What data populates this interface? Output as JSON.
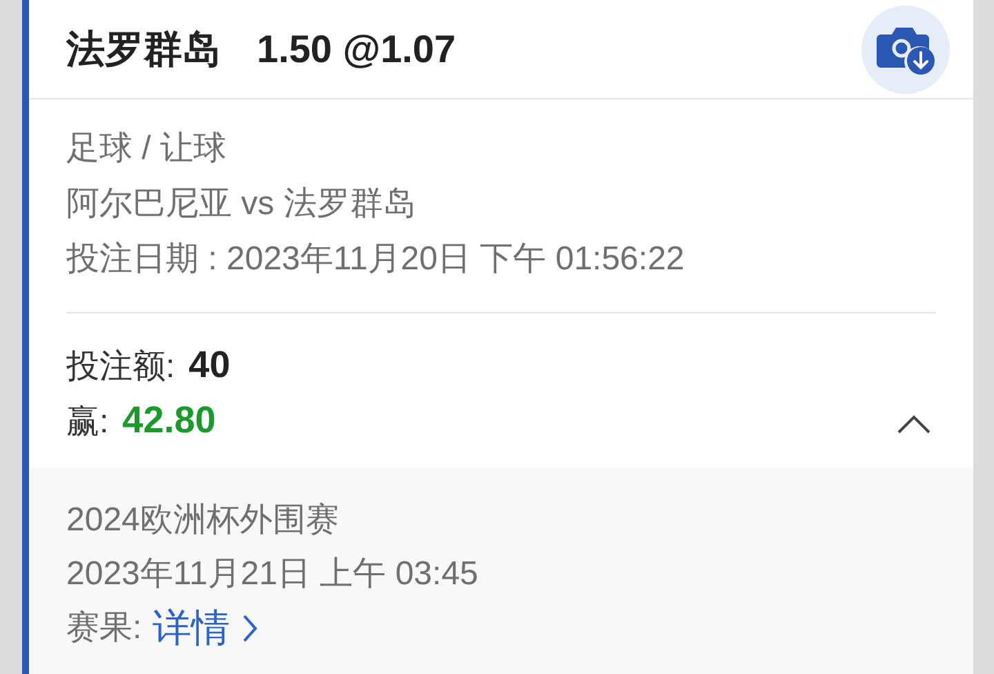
{
  "header": {
    "selection": "法罗群岛",
    "odds": "1.50 @1.07"
  },
  "details": {
    "sport": "足球 / 让球",
    "match": "阿尔巴尼亚 vs 法罗群岛",
    "bet_date": "投注日期 : 2023年11月20日 下午 01:56:22"
  },
  "amounts": {
    "stake_label": "投注额:",
    "stake": "40",
    "win_label": "赢:",
    "win": "42.80",
    "expanded": true
  },
  "event": {
    "league": "2024欧洲杯外围赛",
    "time": "2023年11月21日 上午 03:45",
    "result_label": "赛果:",
    "result_link": "详情"
  }
}
